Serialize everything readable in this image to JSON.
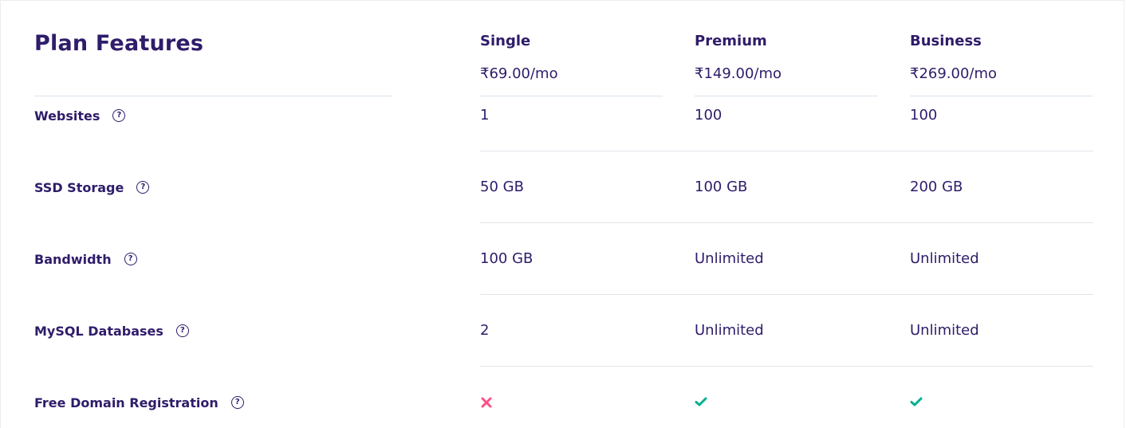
{
  "title": "Plan Features",
  "plans": [
    {
      "name": "Single",
      "price": "₹69.00/mo"
    },
    {
      "name": "Premium",
      "price": "₹149.00/mo"
    },
    {
      "name": "Business",
      "price": "₹269.00/mo"
    }
  ],
  "features": [
    {
      "label": "Websites",
      "help_icon": "question-circle-icon",
      "values": [
        "1",
        "100",
        "100"
      ]
    },
    {
      "label": "SSD Storage",
      "help_icon": "question-circle-icon",
      "values": [
        "50 GB",
        "100 GB",
        "200 GB"
      ]
    },
    {
      "label": "Bandwidth",
      "help_icon": "question-circle-icon",
      "values": [
        "100 GB",
        "Unlimited",
        "Unlimited"
      ]
    },
    {
      "label": "MySQL Databases",
      "help_icon": "question-circle-icon",
      "values": [
        "2",
        "Unlimited",
        "Unlimited"
      ]
    },
    {
      "label": "Free Domain Registration",
      "help_icon": "question-circle-icon",
      "values": [
        false,
        true,
        true
      ]
    }
  ],
  "colors": {
    "text": "#2f1c6a",
    "check": "#00b090",
    "cross": "#fc5185",
    "divider": "#e3e5ea",
    "header_divider": "#dae4f1"
  },
  "help_glyph": "?"
}
